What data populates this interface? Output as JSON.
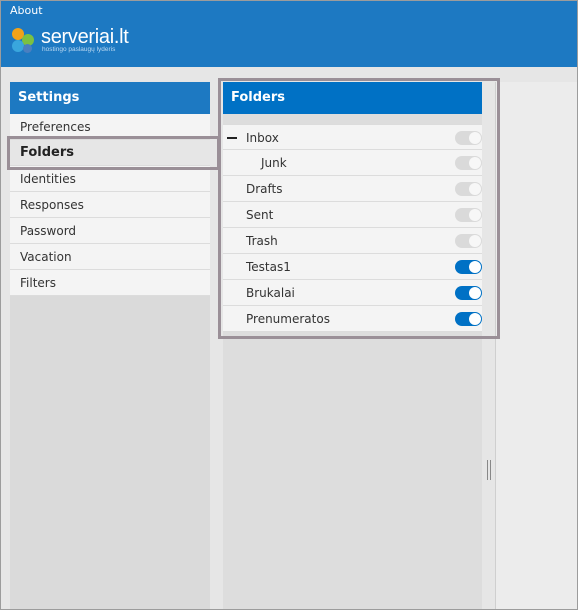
{
  "header": {
    "about_link": "About",
    "logo": {
      "name": "serveriai.lt",
      "tagline": "hostingo paslaugų lyderis"
    }
  },
  "settings": {
    "title": "Settings",
    "items": [
      {
        "label": "Preferences",
        "selected": false
      },
      {
        "label": "Folders",
        "selected": true
      },
      {
        "label": "Identities",
        "selected": false
      },
      {
        "label": "Responses",
        "selected": false
      },
      {
        "label": "Password",
        "selected": false
      },
      {
        "label": "Vacation",
        "selected": false
      },
      {
        "label": "Filters",
        "selected": false
      }
    ]
  },
  "folders": {
    "title": "Folders",
    "items": [
      {
        "label": "Inbox",
        "subscribed": false,
        "collapsible": true,
        "toggle_enabled": false
      },
      {
        "label": "Junk",
        "subscribed": false,
        "child": true,
        "toggle_enabled": false
      },
      {
        "label": "Drafts",
        "subscribed": false,
        "toggle_enabled": false
      },
      {
        "label": "Sent",
        "subscribed": false,
        "toggle_enabled": false
      },
      {
        "label": "Trash",
        "subscribed": false,
        "toggle_enabled": false
      },
      {
        "label": "Testas1",
        "subscribed": true,
        "toggle_enabled": true
      },
      {
        "label": "Brukalai",
        "subscribed": true,
        "toggle_enabled": true
      },
      {
        "label": "Prenumeratos",
        "subscribed": true,
        "toggle_enabled": true
      }
    ]
  },
  "colors": {
    "header_bg": "#1d79c2",
    "accent": "#0071c5",
    "highlight_outline": "#9a8f97"
  },
  "icons": {
    "collapse": "minus-icon",
    "splitter": "drag-handle-icon"
  }
}
